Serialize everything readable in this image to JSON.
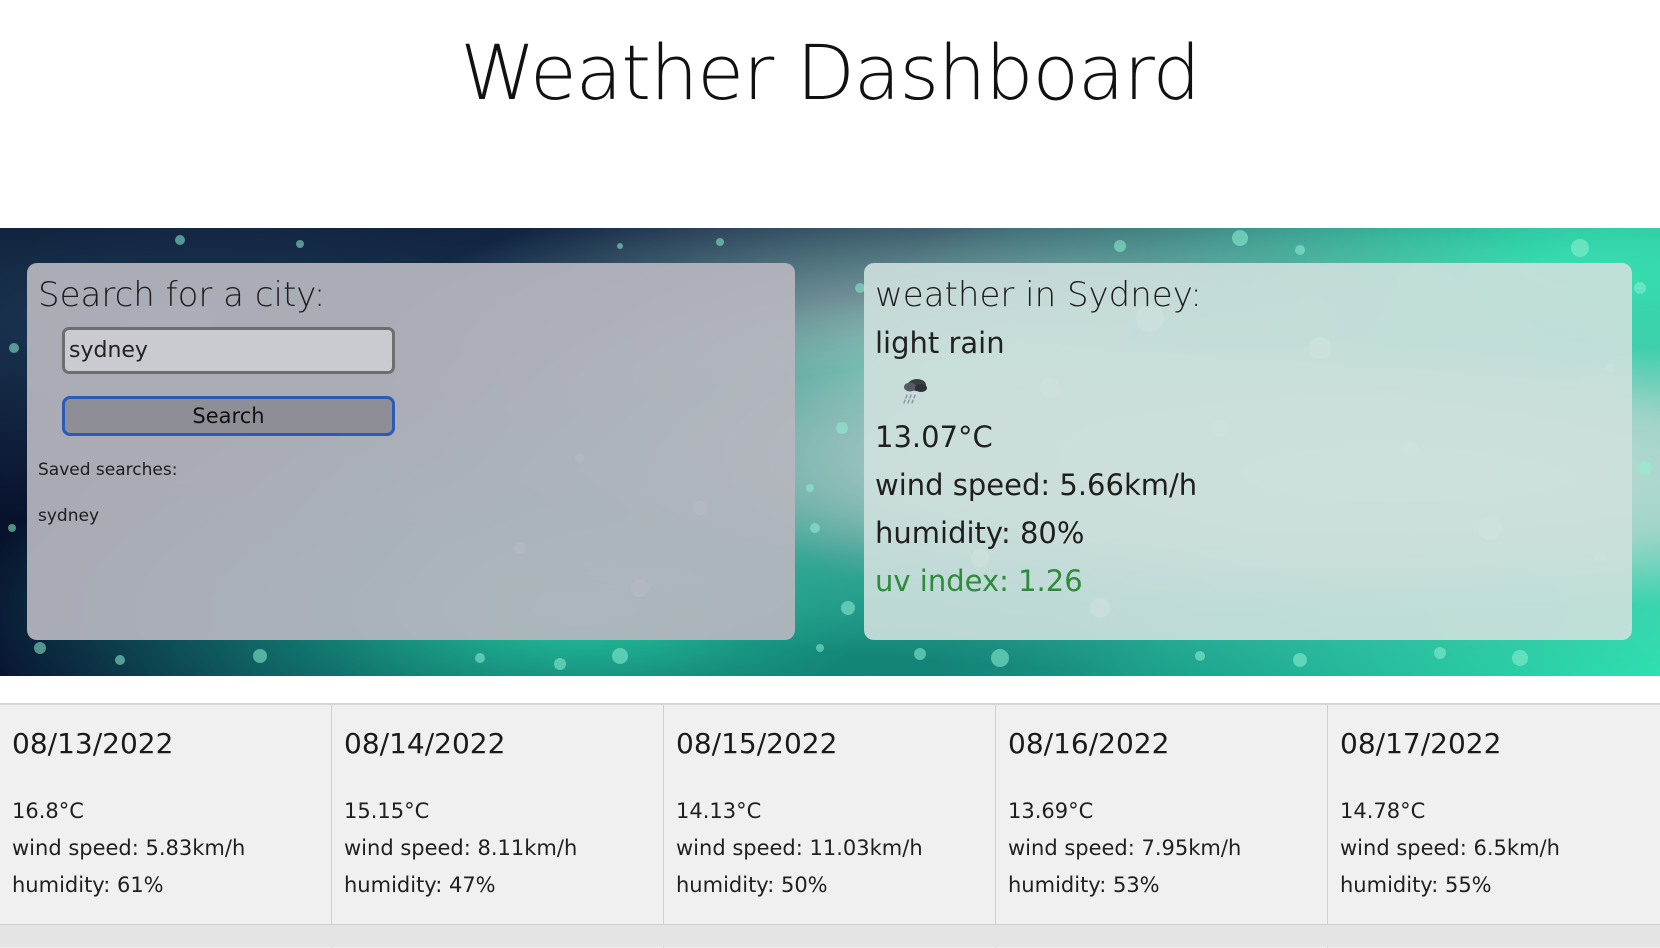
{
  "header": {
    "title": "Weather Dashboard"
  },
  "search": {
    "heading": "Search for a city:",
    "input_value": "sydney",
    "button_label": "Search",
    "saved_label": "Saved searches:",
    "saved_items": [
      "sydney"
    ]
  },
  "current": {
    "heading": "weather in Sydney:",
    "description": "light rain",
    "icon": "light-rain-cloud-icon",
    "temperature": "13.07°C",
    "wind": "wind speed: 5.66km/h",
    "humidity": "humidity: 80%",
    "uv": "uv index: 1.26",
    "uv_color": "#2e8b3a"
  },
  "forecast": [
    {
      "date": "08/13/2022",
      "temp": "16.8°C",
      "wind": "wind speed: 5.83km/h",
      "humidity": "humidity: 61%"
    },
    {
      "date": "08/14/2022",
      "temp": "15.15°C",
      "wind": "wind speed: 8.11km/h",
      "humidity": "humidity: 47%"
    },
    {
      "date": "08/15/2022",
      "temp": "14.13°C",
      "wind": "wind speed: 11.03km/h",
      "humidity": "humidity: 50%"
    },
    {
      "date": "08/16/2022",
      "temp": "13.69°C",
      "wind": "wind speed: 7.95km/h",
      "humidity": "humidity: 53%"
    },
    {
      "date": "08/17/2022",
      "temp": "14.78°C",
      "wind": "wind speed: 6.5km/h",
      "humidity": "humidity: 55%"
    }
  ]
}
